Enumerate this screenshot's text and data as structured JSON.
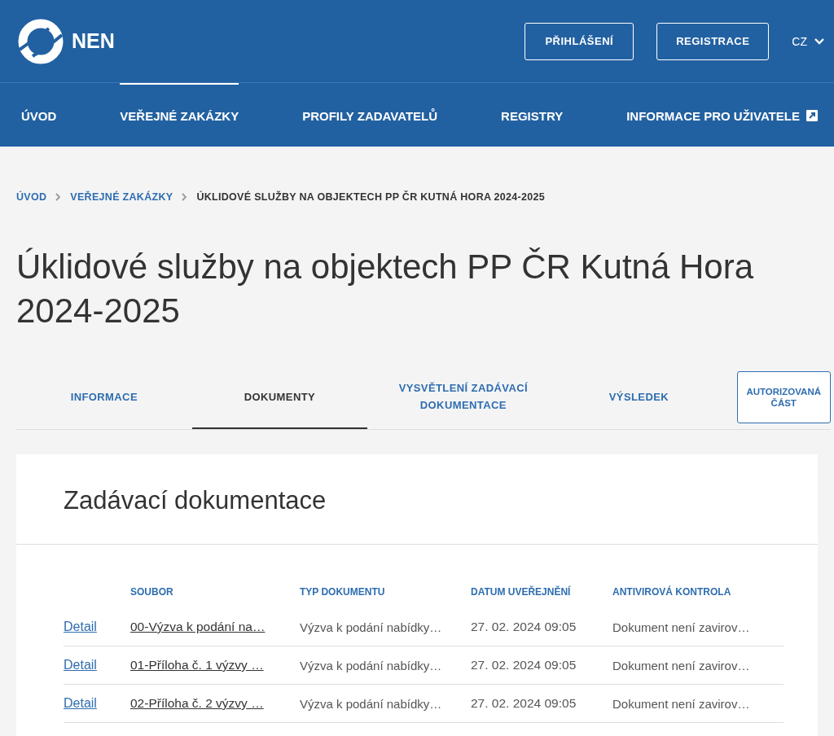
{
  "header": {
    "logo_text": "NEN",
    "login_button": "PŘIHLÁŠENÍ",
    "register_button": "REGISTRACE",
    "language": "CZ"
  },
  "nav": [
    {
      "label": "ÚVOD",
      "selected": false,
      "external": false
    },
    {
      "label": "VEŘEJNÉ ZAKÁZKY",
      "selected": true,
      "external": false
    },
    {
      "label": "PROFILY ZADAVATELŮ",
      "selected": false,
      "external": false
    },
    {
      "label": "REGISTRY",
      "selected": false,
      "external": false
    },
    {
      "label": "INFORMACE PRO UŽIVATELE",
      "selected": false,
      "external": true
    }
  ],
  "breadcrumb": [
    "ÚVOD",
    "VEŘEJNÉ ZAKÁZKY",
    "ÚKLIDOVÉ SLUŽBY NA OBJEKTECH PP ČR KUTNÁ HORA 2024-2025"
  ],
  "page_title": "Úklidové služby na objektech PP ČR Kutná Hora 2024-2025",
  "tabs": [
    {
      "label": "INFORMACE",
      "selected": false
    },
    {
      "label": "DOKUMENTY",
      "selected": true
    },
    {
      "label": "VYSVĚTLENÍ ZADÁVACÍ DOKUMENTACE",
      "selected": false
    },
    {
      "label": "VÝSLEDEK",
      "selected": false
    }
  ],
  "authorized_button": "AUTORIZOVANÁ ČÁST",
  "section": {
    "title": "Zadávací dokumentace",
    "table": {
      "columns": [
        "SOUBOR",
        "TYP DOKUMENTU",
        "DATUM UVEŘEJNĚNÍ",
        "ANTIVIROVÁ KONTROLA"
      ],
      "rows": [
        {
          "link": "Detail",
          "file": "00-Výzva k podání na…",
          "type": "Výzva k podání nabídky…",
          "date": "27. 02. 2024 09:05",
          "antivirus": "Dokument není zavirov…"
        },
        {
          "link": "Detail",
          "file": "01-Příloha č. 1 výzvy …",
          "type": "Výzva k podání nabídky…",
          "date": "27. 02. 2024 09:05",
          "antivirus": "Dokument není zavirov…"
        },
        {
          "link": "Detail",
          "file": "02-Příloha č. 2 výzvy …",
          "type": "Výzva k podání nabídky…",
          "date": "27. 02. 2024 09:05",
          "antivirus": "Dokument není zavirov…"
        }
      ]
    }
  }
}
